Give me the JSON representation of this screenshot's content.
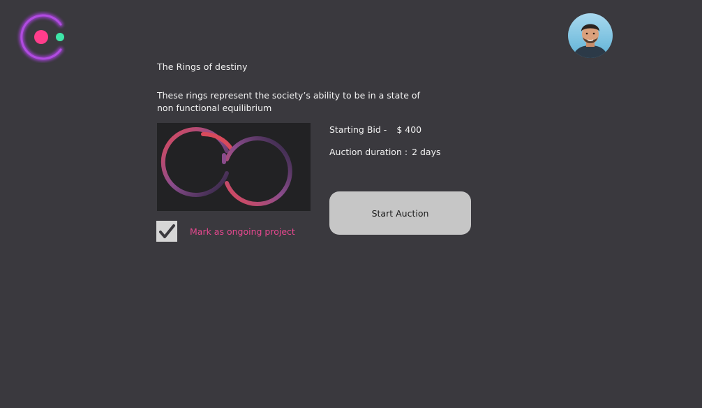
{
  "brand": {
    "logo_icon": "logo-ring-icon",
    "ring_color": "#a33fd6",
    "dot_pink": "#ff3d8b",
    "dot_green": "#3ee6a8"
  },
  "user": {
    "avatar_icon": "user-avatar"
  },
  "item": {
    "title": "The Rings of destiny",
    "description": "These rings represent the society’s ability to be in a state of non functional equilibrium",
    "artwork_icon": "rings-artwork"
  },
  "auction": {
    "starting_bid_label": "Starting Bid -",
    "starting_bid_value": "$ 400",
    "duration_label": "Auction duration :",
    "duration_value": "2 days",
    "start_button_label": "Start Auction"
  },
  "ongoing": {
    "checked": true,
    "label": "Mark as ongoing project"
  },
  "colors": {
    "background": "#3a393e",
    "accent_pink": "#e6488f",
    "button_bg": "#c6c6c6"
  }
}
